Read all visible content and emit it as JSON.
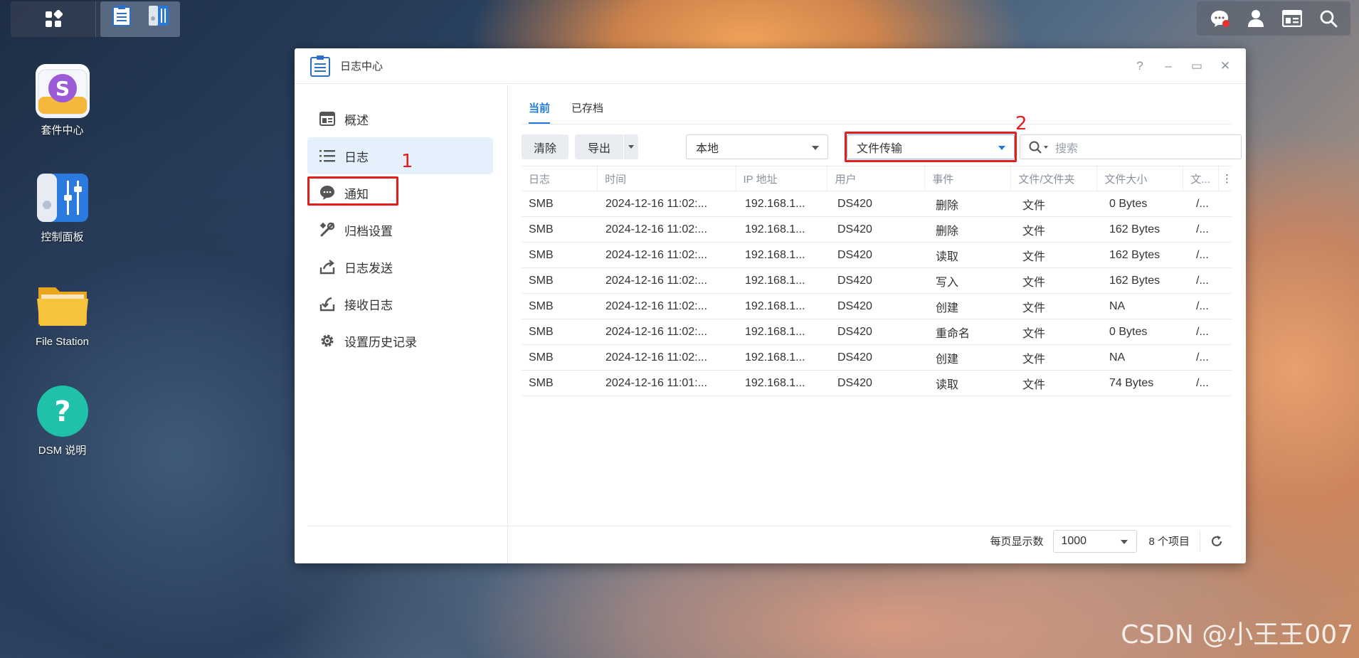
{
  "desktop": {
    "icons": [
      {
        "label": "套件中心"
      },
      {
        "label": "控制面板"
      },
      {
        "label": "File Station"
      },
      {
        "label": "DSM 说明"
      }
    ]
  },
  "window": {
    "title": "日志中心",
    "controls": {
      "help": "?",
      "minimize": "–",
      "maximize": "▭",
      "close": "✕"
    }
  },
  "sidebar": {
    "items": [
      {
        "label": "概述",
        "icon": "overview-icon"
      },
      {
        "label": "日志",
        "icon": "list-icon",
        "active": true
      },
      {
        "label": "通知",
        "icon": "chat-bubble-icon"
      },
      {
        "label": "归档设置",
        "icon": "tools-icon"
      },
      {
        "label": "日志发送",
        "icon": "upload-icon"
      },
      {
        "label": "接收日志",
        "icon": "download-icon"
      },
      {
        "label": "设置历史记录",
        "icon": "gear-icon"
      }
    ]
  },
  "annotations": {
    "one": "1",
    "two": "2"
  },
  "tabs": [
    {
      "label": "当前",
      "active": true
    },
    {
      "label": "已存档"
    }
  ],
  "toolbar": {
    "clear_label": "清除",
    "export_label": "导出",
    "source_value": "本地",
    "type_value": "文件传输",
    "search_placeholder": "搜索"
  },
  "table": {
    "columns": [
      "日志",
      "时间",
      "IP 地址",
      "用户",
      "事件",
      "文件/文件夹",
      "文件大小",
      "文..."
    ],
    "rows": [
      [
        "SMB",
        "2024-12-16 11:02:...",
        "192.168.1...",
        "DS420",
        "删除",
        "文件",
        "0 Bytes",
        "/..."
      ],
      [
        "SMB",
        "2024-12-16 11:02:...",
        "192.168.1...",
        "DS420",
        "删除",
        "文件",
        "162 Bytes",
        "/..."
      ],
      [
        "SMB",
        "2024-12-16 11:02:...",
        "192.168.1...",
        "DS420",
        "读取",
        "文件",
        "162 Bytes",
        "/..."
      ],
      [
        "SMB",
        "2024-12-16 11:02:...",
        "192.168.1...",
        "DS420",
        "写入",
        "文件",
        "162 Bytes",
        "/..."
      ],
      [
        "SMB",
        "2024-12-16 11:02:...",
        "192.168.1...",
        "DS420",
        "创建",
        "文件",
        "NA",
        "/..."
      ],
      [
        "SMB",
        "2024-12-16 11:02:...",
        "192.168.1...",
        "DS420",
        "重命名",
        "文件",
        "0 Bytes",
        "/..."
      ],
      [
        "SMB",
        "2024-12-16 11:02:...",
        "192.168.1...",
        "DS420",
        "创建",
        "文件",
        "NA",
        "/..."
      ],
      [
        "SMB",
        "2024-12-16 11:01:...",
        "192.168.1...",
        "DS420",
        "读取",
        "文件",
        "74 Bytes",
        "/..."
      ]
    ]
  },
  "footer": {
    "per_page_label": "每页显示数",
    "per_page_value": "1000",
    "count_label": "8 个项目"
  },
  "watermark": "CSDN @小王王007",
  "colors": {
    "accent": "#1e7ad8",
    "highlight_box": "#e11d1d",
    "active_bg": "#e4f0fc"
  }
}
